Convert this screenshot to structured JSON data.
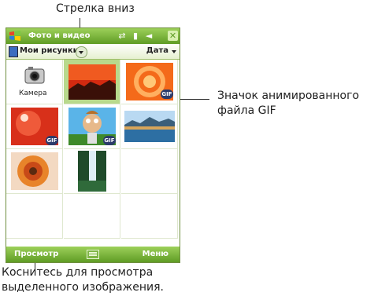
{
  "callouts": {
    "down_arrow": "Стрелка вниз",
    "gif_icon_line1": "Значок анимированного",
    "gif_icon_line2": "файла GIF",
    "tap_to_view_line1": "Коснитесь для просмотра",
    "tap_to_view_line2": "выделенного изображения."
  },
  "window": {
    "title": "Фото и видео",
    "close_label": "✕"
  },
  "toolbar": {
    "folder_name": "Мои рисунки",
    "sort_label": "Дата"
  },
  "grid": {
    "camera_label": "Камера",
    "gif_badge_text": "GIF"
  },
  "softkeys": {
    "left": "Просмотр",
    "right": "Меню"
  },
  "colors": {
    "accent": "#5f9c25",
    "selection": "#b8d98c"
  },
  "icons": [
    "windows-start-icon",
    "sync-icon",
    "signal-icon",
    "speaker-icon",
    "close-icon",
    "folder-icon",
    "chevron-down-icon",
    "camera-icon",
    "keyboard-icon",
    "gif-animation-icon"
  ]
}
